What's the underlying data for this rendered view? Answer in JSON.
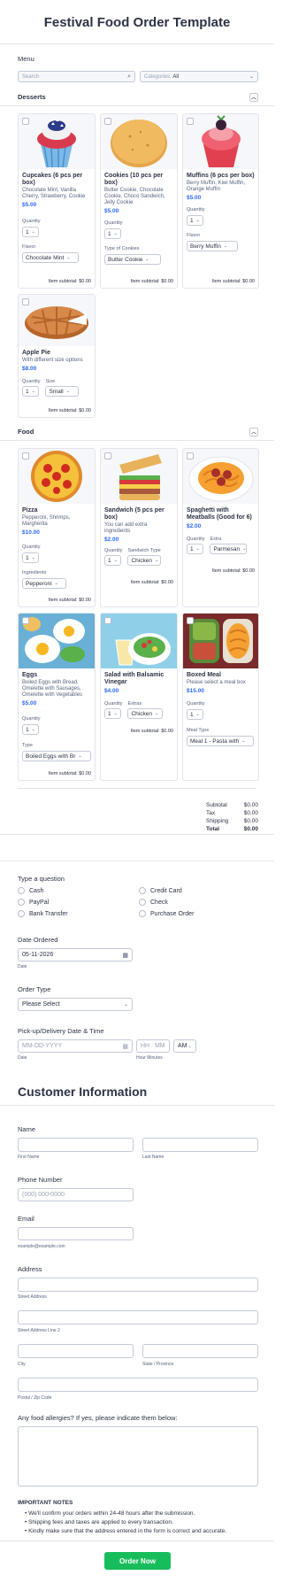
{
  "title": "Festival Food Order Template",
  "menu": {
    "label": "Menu",
    "search_placeholder": "Search",
    "categories_label": "Categories:",
    "categories_value": "All"
  },
  "desserts": {
    "heading": "Desserts",
    "items": [
      {
        "name": "Cupcakes (6 pcs per box)",
        "desc": "Chocolate Mint, Vanilla Cherry, Strawberry, Cookie",
        "price": "$5.00",
        "qty_label": "Quantity",
        "qty": "1",
        "opt_label": "Flavor",
        "opt_value": "Chocolate Mint",
        "subtotal": "Item subtotal: $0.00"
      },
      {
        "name": "Cookies (10 pcs per box)",
        "desc": "Butter Cookie, Chocolate Cookie, Choco Sandwich, Jelly Cookie",
        "price": "$5.00",
        "qty_label": "Quantity",
        "qty": "1",
        "opt_label": "Type of Cookies",
        "opt_value": "Butter Cookie",
        "subtotal": "Item subtotal: $0.00"
      },
      {
        "name": "Muffins (6 pcs per box)",
        "desc": "Berry Muffin, Kiwi Muffin, Orange Muffin",
        "price": "$5.00",
        "qty_label": "Quantity",
        "qty": "1",
        "opt_label": "Flavor",
        "opt_value": "Berry Muffin",
        "subtotal": "Item subtotal: $0.00"
      },
      {
        "name": "Apple Pie",
        "desc": "With different size options",
        "price": "$8.00",
        "qty_label": "Quantity",
        "qty": "1",
        "opt_label": "Size",
        "opt_value": "Small",
        "subtotal": "Item subtotal: $0.00"
      }
    ]
  },
  "food": {
    "heading": "Food",
    "items": [
      {
        "name": "Pizza",
        "desc": "Pepperoni, Shrimps, Margherita",
        "price": "$10.00",
        "qty_label": "Quantity",
        "qty": "1",
        "opt_label": "Ingredients",
        "opt_value": "Pepperoni",
        "subtotal": "Item subtotal: $0.00"
      },
      {
        "name": "Sandwich (5 pcs per box)",
        "desc": "You can add extra ingredients",
        "price": "$2.00",
        "qty_label": "Quantity",
        "qty": "1",
        "opt_label": "Sandwich Type",
        "opt_value": "Chicken",
        "subtotal": "Item subtotal: $0.00"
      },
      {
        "name": "Spaghetti with Meatballs (Good for 6)",
        "desc": "",
        "price": "$2.00",
        "qty_label": "Quantity",
        "qty": "1",
        "opt_label": "Extra",
        "opt_value": "Parmesan",
        "subtotal": "Item subtotal: $0.00"
      },
      {
        "name": "Eggs",
        "desc": "Boiled Eggs with Bread, Omelette with Sausages, Omelette with Vegetables",
        "price": "$5.00",
        "qty_label": "Quantity",
        "qty": "1",
        "opt_label": "Type",
        "opt_value": "Boiled Eggs with Br",
        "subtotal": "Item subtotal: $0.00"
      },
      {
        "name": "Salad with Balsamic Vinegar",
        "desc": "",
        "price": "$4.00",
        "qty_label": "Quantity",
        "qty": "1",
        "opt_label": "Extras",
        "opt_value": "Chicken",
        "subtotal": "Item subtotal: $0.00"
      },
      {
        "name": "Boxed Meal",
        "desc": "Please select a meal box",
        "price": "$15.00",
        "qty_label": "Quantity",
        "qty": "1",
        "opt_label": "Meal Type",
        "opt_value": "Meal 1 - Pasta with",
        "subtotal": ""
      }
    ]
  },
  "totals": [
    {
      "label": "Subtotal",
      "value": "$0.00"
    },
    {
      "label": "Tax",
      "value": "$0.00"
    },
    {
      "label": "Shipping",
      "value": "$0.00"
    },
    {
      "label": "Total",
      "value": "$0.00"
    }
  ],
  "payment": {
    "question": "Type a question",
    "options": [
      "Cash",
      "Credit Card",
      "PayPal",
      "Check",
      "Bank Transfer",
      "Purchase Order"
    ]
  },
  "date_ordered": {
    "label": "Date Ordered",
    "value": "05-11-2026",
    "sub": "Date"
  },
  "order_type": {
    "label": "Order Type",
    "value": "Please Select"
  },
  "pickup": {
    "label": "Pick-up/Delivery Date & Time",
    "date_ph": "MM-DD-YYYY",
    "time_ph": "HH : MM",
    "ampm": "AM",
    "date_sub": "Date",
    "time_sub": "Hour Minutes"
  },
  "customer": {
    "heading": "Customer Information",
    "name_label": "Name",
    "first": "First Name",
    "last": "Last Name",
    "phone_label": "Phone Number",
    "phone_ph": "(000) 000-0000",
    "email_label": "Email",
    "email_sub": "example@example.com",
    "address_label": "Address",
    "street": "Street Address",
    "street2": "Street Address Line 2",
    "city": "City",
    "state": "State / Province",
    "postal": "Postal / Zip Code",
    "allergy_label": "Any food allergies? If yes, please indicate them below:"
  },
  "notes": {
    "heading": "IMPORTANT NOTES",
    "items": [
      "We'll confirm your orders within 24-48 hours after the submission.",
      "Shipping fees and taxes are applied to every transaction.",
      "Kindly make sure that the address entered in the form is correct and accurate."
    ]
  },
  "submit": "Order Now",
  "colors": {
    "accent": "#2e69ff",
    "submit": "#18bd5b",
    "text": "#2c3345"
  }
}
